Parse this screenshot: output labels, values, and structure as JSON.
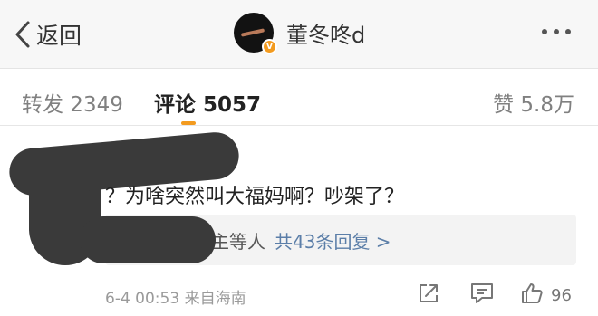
{
  "navbar": {
    "back_label": "返回",
    "username": "董冬咚d",
    "badge": "V",
    "accent_color": "#f39b1f"
  },
  "tabs": {
    "repost": "转发 2349",
    "comment": "评论 5057",
    "like": "赞 5.8万"
  },
  "comment": {
    "text": "？为啥突然叫大福妈啊？吵架了？",
    "replies_names": "主等人",
    "replies_link": "共43条回复 >",
    "timestamp": "6-4 00:53",
    "source": "来自海南",
    "like_count": "96"
  },
  "icons": [
    "back-chevron-icon",
    "more-dots-icon",
    "verified-v-icon",
    "share-icon",
    "comment-icon",
    "thumbs-up-icon"
  ]
}
